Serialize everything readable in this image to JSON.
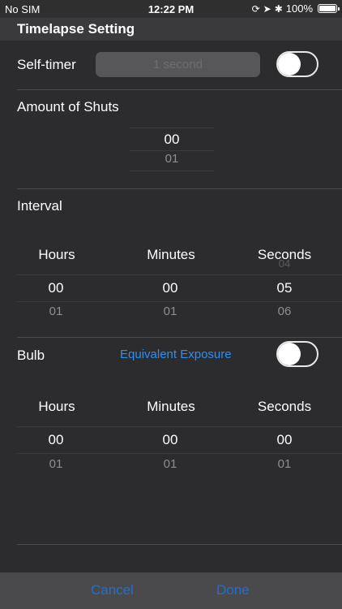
{
  "status_bar": {
    "carrier": "No SIM",
    "time": "12:22 PM",
    "battery": "100%",
    "icons": [
      "rotation-lock-icon",
      "location-arrow-icon",
      "bluetooth-icon",
      "battery-icon"
    ]
  },
  "header": {
    "title": "Timelapse Setting"
  },
  "self_timer": {
    "label": "Self-timer",
    "value": "1 second",
    "toggle_on": false
  },
  "amount_of_shuts": {
    "label": "Amount of Shuts",
    "selected": "00",
    "next": "01"
  },
  "interval": {
    "label": "Interval",
    "columns": [
      {
        "header": "Hours",
        "above": "",
        "selected": "00",
        "below": "01"
      },
      {
        "header": "Minutes",
        "above": "",
        "selected": "00",
        "below": "01"
      },
      {
        "header": "Seconds",
        "above": "04",
        "selected": "05",
        "below": "06"
      }
    ]
  },
  "bulb": {
    "label": "Bulb",
    "link": "Equivalent Exposure",
    "toggle_on": false,
    "columns": [
      {
        "header": "Hours",
        "selected": "00",
        "below": "01"
      },
      {
        "header": "Minutes",
        "selected": "00",
        "below": "01"
      },
      {
        "header": "Seconds",
        "selected": "00",
        "below": "01"
      }
    ]
  },
  "footer": {
    "cancel": "Cancel",
    "done": "Done"
  },
  "colors": {
    "background": "#2c2c2e",
    "accent_blue": "#2e8ef0",
    "footer_button": "#1f6fd6"
  }
}
